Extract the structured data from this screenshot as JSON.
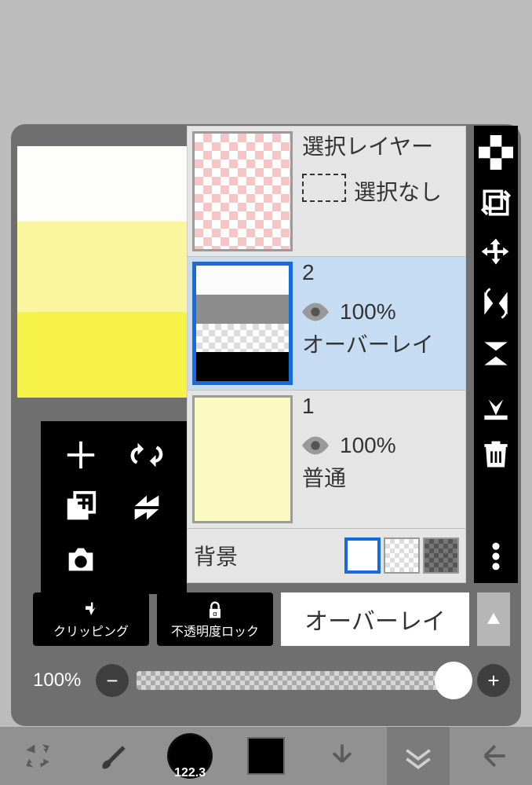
{
  "layers": {
    "selection": {
      "title": "選択レイヤー",
      "status": "選択なし"
    },
    "layer2": {
      "name": "2",
      "opacity": "100%",
      "blend": "オーバーレイ"
    },
    "layer1": {
      "name": "1",
      "opacity": "100%",
      "blend": "普通"
    },
    "bg_label": "背景"
  },
  "bottom": {
    "clipping": "クリッピング",
    "alpha_lock": "不透明度ロック",
    "blend_mode": "オーバーレイ"
  },
  "slider": {
    "value": "100%"
  },
  "toolbar": {
    "brush_size": "122.3"
  },
  "icons": {
    "plus": "plus",
    "flip_h": "flip-horizontal",
    "duplicate": "duplicate",
    "flip_v": "flip-rotate",
    "camera": "camera",
    "checker": "checker",
    "transform": "transform",
    "move": "move",
    "flip_h2": "flip-h",
    "flip_v2": "flip-v",
    "merge": "merge-down",
    "trash": "trash",
    "more": "more"
  }
}
